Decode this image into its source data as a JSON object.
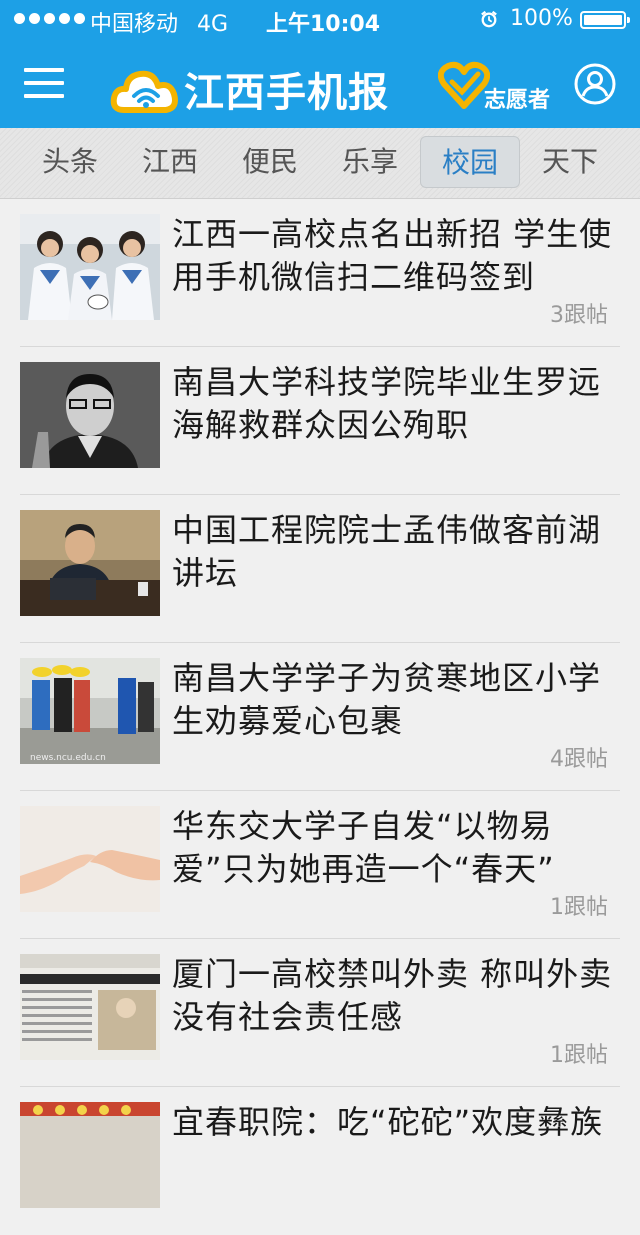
{
  "status_bar": {
    "carrier": "中国移动",
    "network": "4G",
    "time": "上午10:04",
    "battery": "100%",
    "battery_level": 1.0
  },
  "header": {
    "logo_text": "江西手机报",
    "volunteer_label": "志愿者",
    "menu_icon": "menu-icon",
    "user_icon": "user-icon",
    "brand_color": "#1da0e6"
  },
  "tabs": [
    {
      "label": "头条"
    },
    {
      "label": "江西"
    },
    {
      "label": "便民"
    },
    {
      "label": "乐享"
    },
    {
      "label": "校园",
      "active": true
    },
    {
      "label": "天下"
    }
  ],
  "news": [
    {
      "title": "江西一高校点名出新招 学生使用手机微信扫二维码签到",
      "replies": "3跟帖"
    },
    {
      "title": "南昌大学科技学院毕业生罗远海解救群众因公殉职",
      "replies": ""
    },
    {
      "title": "中国工程院院士孟伟做客前湖讲坛",
      "replies": ""
    },
    {
      "title": "南昌大学学子为贫寒地区小学生劝募爱心包裹",
      "replies": "4跟帖"
    },
    {
      "title": "华东交大学子自发“以物易爱”只为她再造一个“春天”",
      "replies": "1跟帖"
    },
    {
      "title": "厦门一高校禁叫外卖 称叫外卖没有社会责任感",
      "replies": "1跟帖"
    },
    {
      "title": "宜春职院：吃“砣砣”欢度彝族",
      "replies": ""
    }
  ]
}
